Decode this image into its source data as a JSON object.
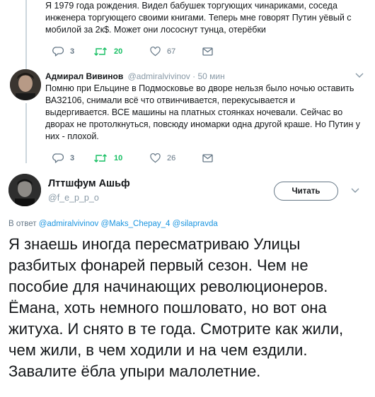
{
  "tweet_prev": {
    "text": "Я 1979 года рождения. Видел бабушек торгующих чинариками, соседа инженера торгующего своими книгами. Теперь мне говорят Путин уёвый с мобилой за 2к$. Может они лососнут тунца, отерёбки",
    "replies": "3",
    "retweets": "20",
    "likes": "67"
  },
  "tweet_reply": {
    "name": "Адмирал Вивинов",
    "handle": "@admiralvivinov",
    "time": "· 50 мин",
    "text": "Помню при Ельцине в Подмосковье во дворе нельзя было ночью оставить ВАЗ2106, снимали всё что отвинчивается, перекусывается и выдергивается. ВСЕ машины на платных стоянках ночевали. Сейчас во дворах не протолкнуться, повсюду иномарки одна другой краше. Но Путин у них - плохой.",
    "replies": "3",
    "retweets": "10",
    "likes": "26"
  },
  "main_tweet": {
    "name": "Лттшфум Ашьф",
    "handle": "@f_e_p_p_o",
    "follow_label": "Читать",
    "reply_prefix": "В ответ",
    "reply_to": "@admiralvivinov @Maks_Chepay_4 @silapravda",
    "text": "Я знаешь иногда пересматриваю Улицы разбитых фонарей первый сезон. Чем не пособие для начинающих революционеров. Ёмана, хоть немного пошловато, но вот она житуха. И снято в те года. Смотрите как жили, чем жили, в чем ходили и на чем ездили. Завалите ёбла упыри малолетние."
  },
  "icons": [
    "reply-icon",
    "retweet-icon",
    "like-icon",
    "dm-icon",
    "chevron-down-icon"
  ],
  "colors": {
    "link": "#1b95e0",
    "retweet_active": "#17bf63",
    "muted": "#657786"
  }
}
